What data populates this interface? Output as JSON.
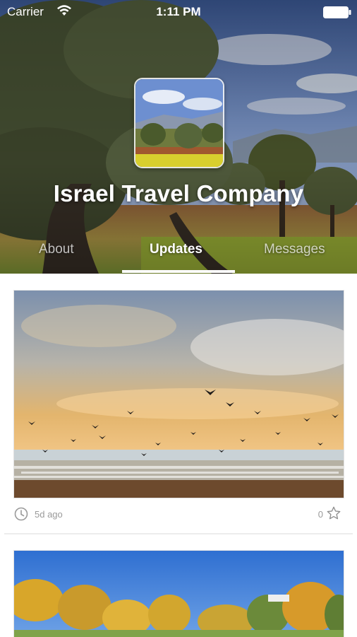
{
  "status_bar": {
    "carrier": "Carrier",
    "time": "1:11 PM",
    "wifi_icon": "wifi-icon",
    "battery_icon": "battery-icon"
  },
  "profile": {
    "title": "Israel Travel Company",
    "avatar": "landscape-thumbnail"
  },
  "tabs": [
    {
      "label": "About",
      "active": false
    },
    {
      "label": "Updates",
      "active": true
    },
    {
      "label": "Messages",
      "active": false
    }
  ],
  "feed": {
    "posts": [
      {
        "image": "cranes-sunset-photo",
        "timestamp": "5d ago",
        "likes": "0",
        "icons": [
          "clock-icon",
          "star-icon"
        ]
      },
      {
        "image": "autumn-trees-photo"
      }
    ]
  },
  "colors": {
    "accent_white": "#ffffff",
    "meta_gray": "#9a9a9a",
    "divider": "#ececec"
  }
}
